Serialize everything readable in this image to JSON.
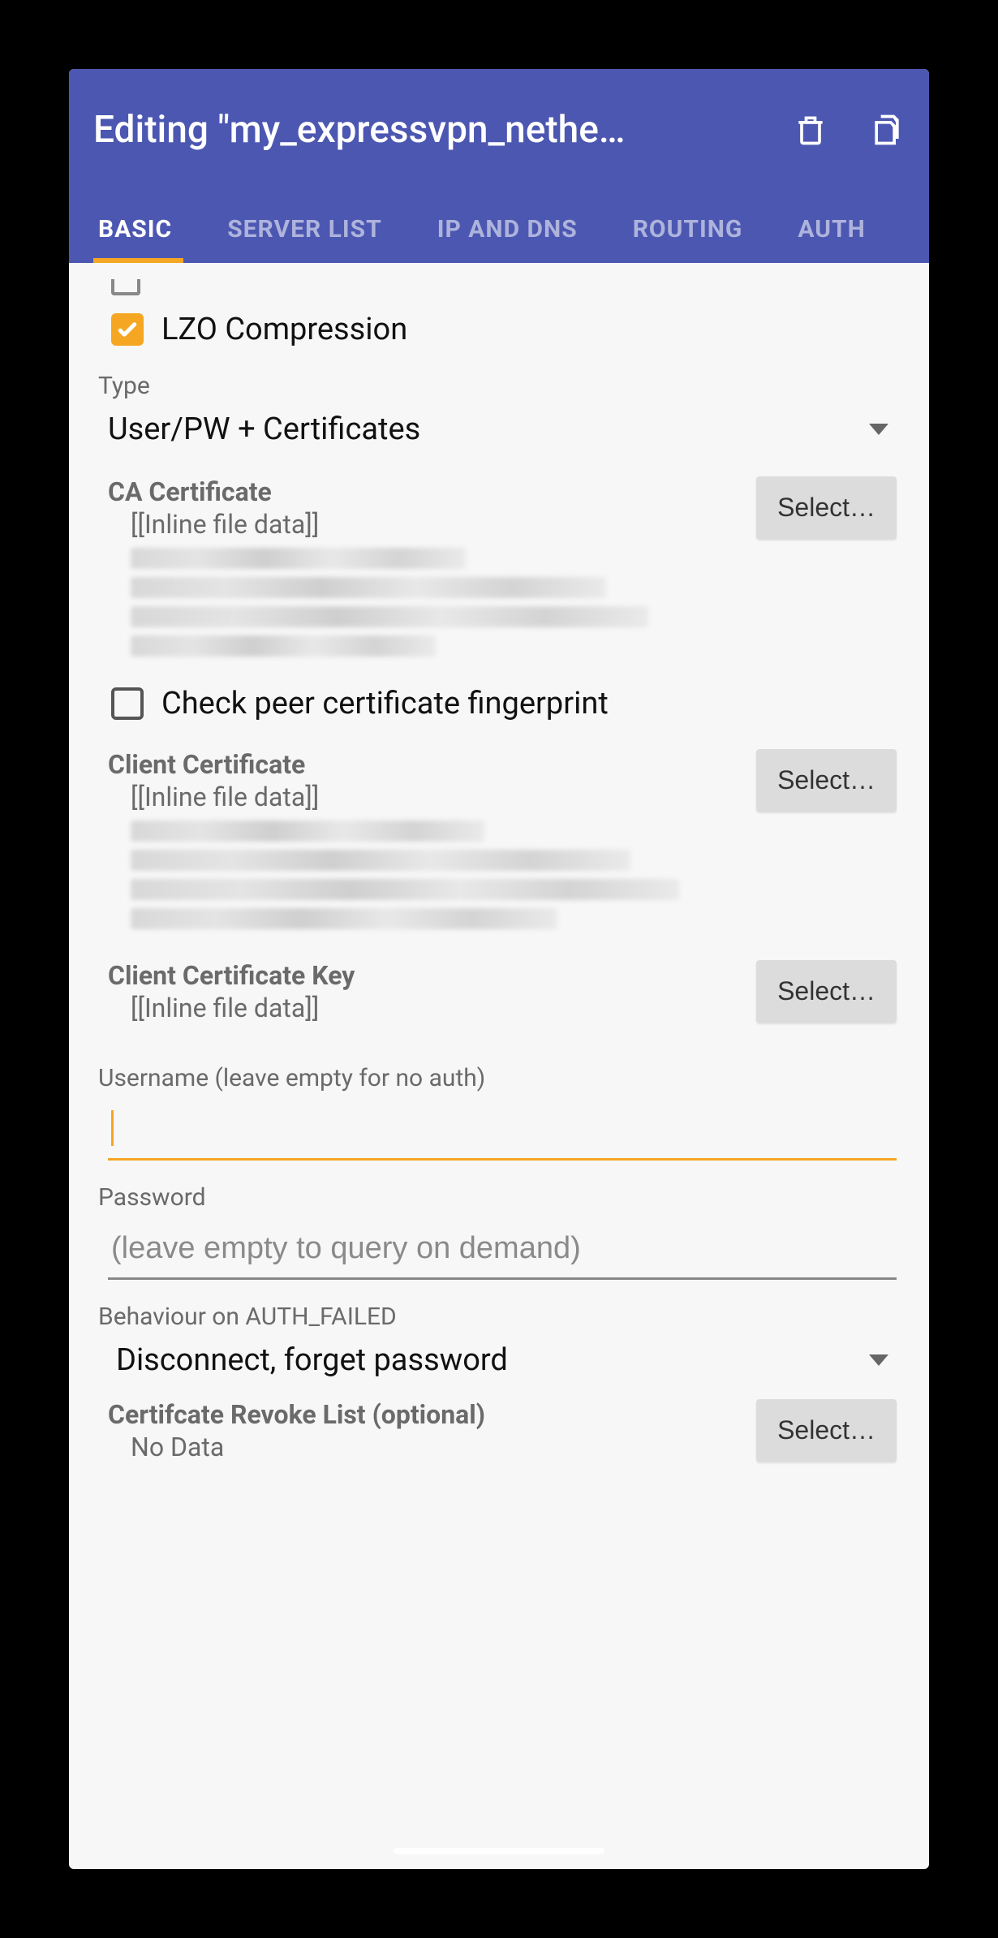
{
  "appbar": {
    "title": "Editing \"my_expressvpn_nethe…",
    "icons": {
      "delete": "delete-icon",
      "copy": "copy-icon"
    }
  },
  "tabs": [
    {
      "id": "basic",
      "label": "BASIC",
      "active": true
    },
    {
      "id": "serverlist",
      "label": "SERVER LIST",
      "active": false
    },
    {
      "id": "ipdns",
      "label": "IP AND DNS",
      "active": false
    },
    {
      "id": "routing",
      "label": "ROUTING",
      "active": false
    },
    {
      "id": "auth",
      "label": "AUTH",
      "active": false
    }
  ],
  "basic": {
    "lzo_label": "LZO Compression",
    "lzo_checked": true,
    "type_label": "Type",
    "type_value": "User/PW + Certificates",
    "ca_cert": {
      "title": "CA Certificate",
      "value": "[[Inline file data]]",
      "select_btn": "Select…"
    },
    "peer_fingerprint": {
      "label": "Check peer certificate fingerprint",
      "checked": false
    },
    "client_cert": {
      "title": "Client Certificate",
      "value": "[[Inline file data]]",
      "select_btn": "Select…"
    },
    "client_cert_key": {
      "title": "Client Certificate Key",
      "value": "[[Inline file data]]",
      "select_btn": "Select…"
    },
    "username": {
      "label": "Username (leave empty for no auth)",
      "value": ""
    },
    "password": {
      "label": "Password",
      "placeholder": "(leave empty to query on demand)",
      "value": ""
    },
    "auth_failed": {
      "label": "Behaviour on AUTH_FAILED",
      "value": "Disconnect, forget password"
    },
    "crl": {
      "title": "Certifcate Revoke List (optional)",
      "value": "No Data",
      "select_btn": "Select…"
    }
  }
}
